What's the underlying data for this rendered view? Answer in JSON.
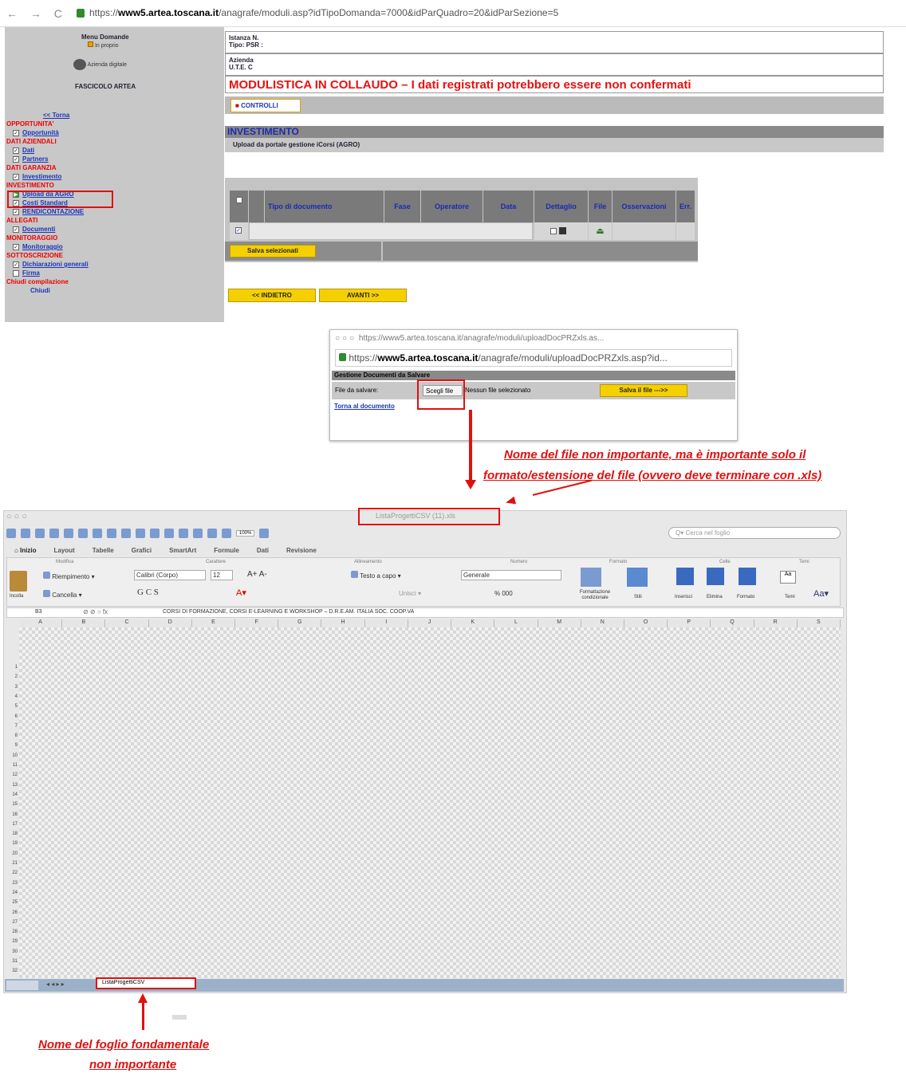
{
  "browser": {
    "url_prefix": "https://",
    "url_host": "www5.artea.toscana.it",
    "url_path": "/anagrafe/moduli.asp?idTipoDomanda=7000&idParQuadro=20&idParSezione=5"
  },
  "menu": {
    "title": "Menu Domande",
    "subtitle": "In proprio",
    "azienda": "Azienda digitale",
    "fascicolo": "FASCICOLO ARTEA",
    "back": "<< Torna",
    "items": [
      {
        "type": "section",
        "label": "OPPORTUNITA'"
      },
      {
        "type": "item",
        "label": "Opportunità",
        "checked": true
      },
      {
        "type": "section",
        "label": "DATI AZIENDALI"
      },
      {
        "type": "item",
        "label": "Dati",
        "checked": true
      },
      {
        "type": "item",
        "label": "Partners",
        "checked": true
      },
      {
        "type": "section",
        "label": "DATI GARANZIA"
      },
      {
        "type": "item",
        "label": "Investimento",
        "checked": true
      },
      {
        "type": "section",
        "label": "INVESTIMENTO"
      },
      {
        "type": "item",
        "label": "Upload da AGRO",
        "checked": true,
        "active": true
      },
      {
        "type": "item",
        "label": "Costi Standard",
        "checked": true
      },
      {
        "type": "item",
        "label": "RENDICONTAZIONE",
        "checked": true
      },
      {
        "type": "section",
        "label": "ALLEGATI"
      },
      {
        "type": "item",
        "label": "Documenti",
        "checked": true
      },
      {
        "type": "section",
        "label": "MONITORAGGIO"
      },
      {
        "type": "item",
        "label": "Monitoraggio",
        "checked": true
      },
      {
        "type": "section",
        "label": "SOTTOSCRIZIONE"
      },
      {
        "type": "item",
        "label": "Dichiarazioni generali",
        "checked": true
      },
      {
        "type": "item",
        "label": "Firma",
        "checked": false
      },
      {
        "type": "section",
        "label": "Chiudi compilazione"
      },
      {
        "type": "plain",
        "label": "Chiudi"
      }
    ]
  },
  "header": {
    "istanza_label": "Istanza N.",
    "tipo_label": "Tipo: PSR :",
    "azienda_label": "Azienda",
    "ute_label": "U.T.E. C",
    "banner": "MODULISTICA IN COLLAUDO – I dati registrati potrebbero essere non confermati",
    "controlli": "CONTROLLI"
  },
  "section": {
    "title": "INVESTIMENTO",
    "subtitle": "Upload da portale gestione iCorsi (AGRO)"
  },
  "table": {
    "columns": [
      "Tipo di documento",
      "Fase",
      "Operatore",
      "Data",
      "Dettaglio",
      "File",
      "Osservazioni",
      "Err."
    ],
    "save_selected": "Salva selezionati"
  },
  "nav": {
    "back": "<< INDIETRO",
    "next": "AVANTI >>"
  },
  "popup": {
    "titlebar": "https://www5.artea.toscana.it/anagrafe/moduli/uploadDocPRZxls.as...",
    "url_prefix": "https://",
    "url_host": "www5.artea.toscana.it",
    "url_path": "/anagrafe/moduli/uploadDocPRZxls.asp?id...",
    "header": "Gestione Documenti da Salvare",
    "file_label": "File da salvare:",
    "choose": "Scegli file",
    "no_file": "Nessun file selezionato",
    "save": "Salva il file --->>",
    "back_link": "Torna al documento"
  },
  "annotations": {
    "file_note_line1": "Nome del file non importante, ma è importante solo il",
    "file_note_line2": "formato/estensione del file (ovvero deve terminare con .xls)",
    "sheet_note_line1": "Nome del foglio fondamentale",
    "sheet_note_line2": "non importante"
  },
  "excel": {
    "window_title": "ListaProgettiCSV (11).xls",
    "search_placeholder": "Cerca nel foglio",
    "zoom": "100%",
    "tabs": [
      "Inizio",
      "Layout",
      "Tabelle",
      "Grafici",
      "SmartArt",
      "Formule",
      "Dati",
      "Revisione"
    ],
    "groups": [
      "Modifica",
      "Carattere",
      "Allineamento",
      "Numero",
      "Formato",
      "Celle",
      "Temi"
    ],
    "fill": "Riempimento",
    "clear": "Cancella",
    "paste": "Incolla",
    "font": "Calibri (Corpo)",
    "font_size": "12",
    "wrap": "Testo a capo",
    "merge": "Unisci",
    "number_format": "Generale",
    "cond_format": "Formattazione condizionale",
    "styles": "Stili",
    "insert": "Inserisci",
    "delete": "Elimina",
    "format": "Formato",
    "themes": "Temi",
    "cell_ref": "B3",
    "formula": "CORSI DI FORMAZIONE, CORSI E-LEARNING E WORKSHOP – D.R.E.AM. ITALIA SOC. COOP.VA",
    "columns": [
      "A",
      "B",
      "C",
      "D",
      "E",
      "F",
      "G",
      "H",
      "I",
      "J",
      "K",
      "L",
      "M",
      "N",
      "O",
      "P",
      "Q",
      "R",
      "S"
    ],
    "rows": [
      "1",
      "2",
      "3",
      "4",
      "5",
      "6",
      "7",
      "8",
      "9",
      "10",
      "11",
      "12",
      "13",
      "14",
      "15",
      "16",
      "17",
      "18",
      "19",
      "20",
      "21",
      "22",
      "23",
      "24",
      "25",
      "26",
      "27",
      "28",
      "29",
      "30",
      "31",
      "32"
    ],
    "sheet_tab": "ListaProgettiCSV"
  }
}
